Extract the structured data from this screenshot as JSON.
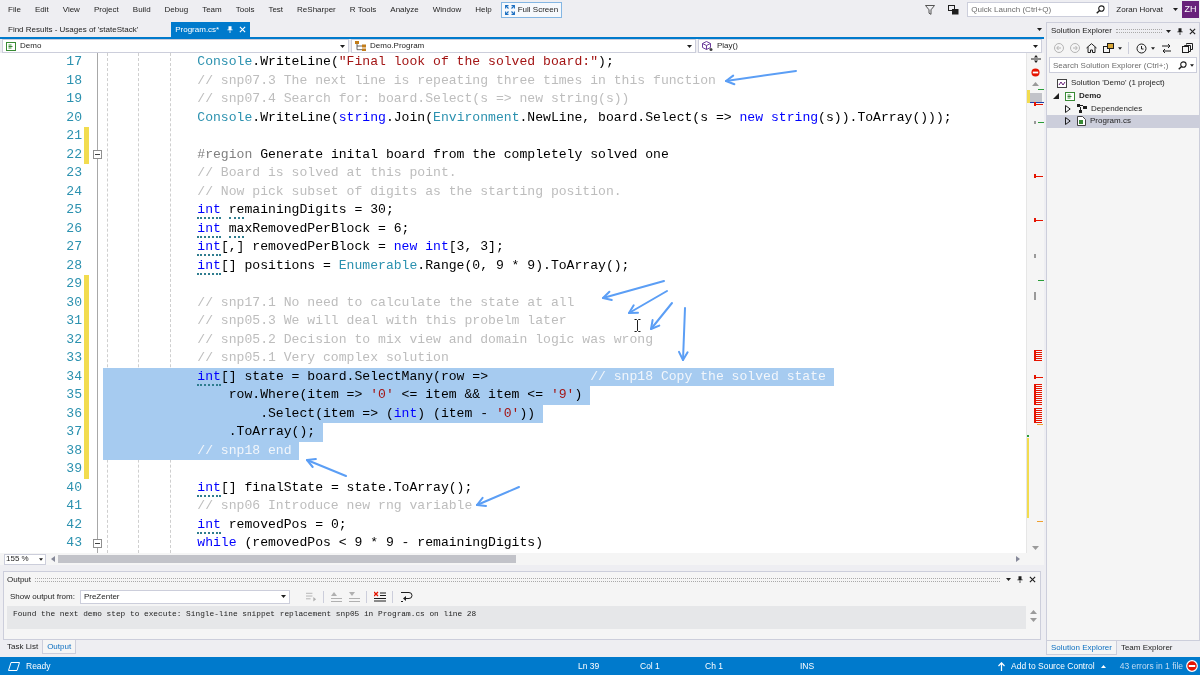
{
  "menu_bar": {
    "items": [
      "File",
      "Edit",
      "View",
      "Project",
      "Build",
      "Debug",
      "Team",
      "Tools",
      "Test",
      "ReSharper",
      "R Tools",
      "Analyze",
      "Window",
      "Help"
    ],
    "full_screen": "Full Screen",
    "quick_launch": {
      "placeholder": "Quick Launch (Ctrl+Q)"
    },
    "user_name": "Zoran Horvat",
    "user_initials": "ZH"
  },
  "document_tabs": [
    {
      "label": "Find Results - Usages of 'stateStack'",
      "selected": false
    },
    {
      "label": "Program.cs*",
      "selected": true
    }
  ],
  "navigation_bar": {
    "project": "Demo",
    "type": "Demo.Program",
    "member": "Play()"
  },
  "editor": {
    "zoom": "155 %",
    "lines": [
      {
        "number": "17",
        "changed": false,
        "fold": false,
        "selected": false,
        "tokens": [
          {
            "kind": "type",
            "text": "            Console",
            "hint": false
          },
          {
            "kind": "plain",
            "text": ".WriteLine(",
            "hint": false
          },
          {
            "kind": "string",
            "text": "\"Final look of the solved board:\"",
            "hint": false
          },
          {
            "kind": "plain",
            "text": ");",
            "hint": false
          }
        ]
      },
      {
        "number": "18",
        "changed": false,
        "fold": false,
        "selected": false,
        "tokens": [
          {
            "kind": "comment",
            "text": "            // snp07.3 The next line is repeating three times in this function",
            "hint": false
          }
        ]
      },
      {
        "number": "19",
        "changed": false,
        "fold": false,
        "selected": false,
        "tokens": [
          {
            "kind": "comment",
            "text": "            // snp07.4 Search for: board.Select(s => new string(s))",
            "hint": false
          }
        ]
      },
      {
        "number": "20",
        "changed": false,
        "fold": false,
        "selected": false,
        "tokens": [
          {
            "kind": "type",
            "text": "            Console",
            "hint": false
          },
          {
            "kind": "plain",
            "text": ".WriteLine(",
            "hint": false
          },
          {
            "kind": "keyword",
            "text": "string",
            "hint": false
          },
          {
            "kind": "plain",
            "text": ".Join(",
            "hint": false
          },
          {
            "kind": "type",
            "text": "Environment",
            "hint": false
          },
          {
            "kind": "plain",
            "text": ".NewLine, board.Select(s => ",
            "hint": false
          },
          {
            "kind": "keyword",
            "text": "new string",
            "hint": false
          },
          {
            "kind": "plain",
            "text": "(s)).ToArray()));",
            "hint": false
          }
        ]
      },
      {
        "number": "21",
        "changed": true,
        "fold": false,
        "selected": false
      },
      {
        "number": "22",
        "changed": true,
        "fold": true,
        "selected": false,
        "tokens": [
          {
            "kind": "preprocessor",
            "text": "            #region",
            "hint": false
          },
          {
            "kind": "plain",
            "text": " Generate inital board from the completely solved one",
            "hint": false
          }
        ]
      },
      {
        "number": "23",
        "changed": false,
        "fold": false,
        "selected": false,
        "tokens": [
          {
            "kind": "comment",
            "text": "            // Board is solved at this point.",
            "hint": false
          }
        ]
      },
      {
        "number": "24",
        "changed": false,
        "fold": false,
        "selected": false,
        "tokens": [
          {
            "kind": "comment",
            "text": "            // Now pick subset of digits as the starting position.",
            "hint": false
          }
        ]
      },
      {
        "number": "25",
        "changed": false,
        "fold": false,
        "selected": false,
        "tokens": [
          {
            "kind": "keyword",
            "text": "            int ",
            "hint": true
          },
          {
            "kind": "plain",
            "text": "re",
            "hint": true
          },
          {
            "kind": "plain",
            "text": "mainingDigits = 30;",
            "hint": false
          }
        ]
      },
      {
        "number": "26",
        "changed": false,
        "fold": false,
        "selected": false,
        "tokens": [
          {
            "kind": "keyword",
            "text": "            int ",
            "hint": true
          },
          {
            "kind": "plain",
            "text": "ma",
            "hint": true
          },
          {
            "kind": "plain",
            "text": "xRemovedPerBlock = 6;",
            "hint": false
          }
        ]
      },
      {
        "number": "27",
        "changed": false,
        "fold": false,
        "selected": false,
        "tokens": [
          {
            "kind": "keyword",
            "text": "            int",
            "hint": true
          },
          {
            "kind": "plain",
            "text": "[,] removedPerBlock = ",
            "hint": false
          },
          {
            "kind": "keyword",
            "text": "new int",
            "hint": false
          },
          {
            "kind": "plain",
            "text": "[3, 3];",
            "hint": false
          }
        ]
      },
      {
        "number": "28",
        "changed": false,
        "fold": false,
        "selected": false,
        "tokens": [
          {
            "kind": "keyword",
            "text": "            int",
            "hint": true
          },
          {
            "kind": "plain",
            "text": "[] positions = ",
            "hint": false
          },
          {
            "kind": "type",
            "text": "Enumerable",
            "hint": false
          },
          {
            "kind": "plain",
            "text": ".Range(0, 9 * 9).ToArray();",
            "hint": false
          }
        ]
      },
      {
        "number": "29",
        "changed": true,
        "fold": false,
        "selected": false
      },
      {
        "number": "30",
        "changed": true,
        "fold": false,
        "selected": false,
        "tokens": [
          {
            "kind": "comment",
            "text": "            // snp17.1 No need to calculate the state at all",
            "hint": false
          }
        ]
      },
      {
        "number": "31",
        "changed": true,
        "fold": false,
        "selected": false,
        "tokens": [
          {
            "kind": "comment",
            "text": "            // snp05.3 We will deal with this probelm later",
            "hint": false
          }
        ]
      },
      {
        "number": "32",
        "changed": true,
        "fold": false,
        "selected": false,
        "tokens": [
          {
            "kind": "comment",
            "text": "            // snp05.2 Decision to mix view and domain logic was wrong",
            "hint": false
          }
        ]
      },
      {
        "number": "33",
        "changed": true,
        "fold": false,
        "selected": false,
        "tokens": [
          {
            "kind": "comment",
            "text": "            // snp05.1 Very complex solution",
            "hint": false
          }
        ]
      },
      {
        "number": "34",
        "changed": true,
        "fold": false,
        "selected": true,
        "tokens": [
          {
            "kind": "keyword",
            "text": "            int",
            "hint": true
          },
          {
            "kind": "plain",
            "text": "[] state = board.SelectMany(row =>             ",
            "hint": false
          },
          {
            "kind": "comment",
            "text": "// snp18 Copy the solved state",
            "hint": false
          }
        ]
      },
      {
        "number": "35",
        "changed": true,
        "fold": false,
        "selected": true,
        "tokens": [
          {
            "kind": "plain",
            "text": "                row.Where(item => ",
            "hint": false
          },
          {
            "kind": "string",
            "text": "'0'",
            "hint": false
          },
          {
            "kind": "plain",
            "text": " <= item && item <= ",
            "hint": false
          },
          {
            "kind": "string",
            "text": "'9'",
            "hint": false
          },
          {
            "kind": "plain",
            "text": ")",
            "hint": false
          }
        ]
      },
      {
        "number": "36",
        "changed": true,
        "fold": false,
        "selected": true,
        "tokens": [
          {
            "kind": "plain",
            "text": "                    .Select(item => (",
            "hint": false
          },
          {
            "kind": "keyword",
            "text": "int",
            "hint": false
          },
          {
            "kind": "plain",
            "text": ") (item - ",
            "hint": false
          },
          {
            "kind": "string",
            "text": "'0'",
            "hint": false
          },
          {
            "kind": "plain",
            "text": "))",
            "hint": false
          }
        ]
      },
      {
        "number": "37",
        "changed": true,
        "fold": false,
        "selected": true,
        "tokens": [
          {
            "kind": "plain",
            "text": "                .ToArray();",
            "hint": false
          }
        ]
      },
      {
        "number": "38",
        "changed": true,
        "fold": false,
        "selected": true,
        "tokens": [
          {
            "kind": "comment",
            "text": "            // snp18 end",
            "hint": false
          }
        ]
      },
      {
        "number": "39",
        "changed": true,
        "fold": false,
        "selected": false
      },
      {
        "number": "40",
        "changed": false,
        "fold": false,
        "selected": false,
        "tokens": [
          {
            "kind": "keyword",
            "text": "            int",
            "hint": true
          },
          {
            "kind": "plain",
            "text": "[] finalState = state.ToArray();",
            "hint": false
          }
        ]
      },
      {
        "number": "41",
        "changed": false,
        "fold": false,
        "selected": false,
        "tokens": [
          {
            "kind": "comment",
            "text": "            // snp06 Introduce new rng variable",
            "hint": false
          }
        ]
      },
      {
        "number": "42",
        "changed": false,
        "fold": false,
        "selected": false,
        "tokens": [
          {
            "kind": "keyword",
            "text": "            int",
            "hint": true
          },
          {
            "kind": "plain",
            "text": " removedPos = 0;",
            "hint": false
          }
        ]
      },
      {
        "number": "43",
        "changed": false,
        "fold": true,
        "selected": false,
        "tokens": [
          {
            "kind": "keyword",
            "text": "            while",
            "hint": false
          },
          {
            "kind": "plain",
            "text": " (removedPos < 9 * 9 - remainingDigits)",
            "hint": false
          }
        ]
      }
    ]
  },
  "output": {
    "title": "Output",
    "source_label": "Show output from:",
    "source": "PreZenter",
    "text": "Found the next demo step to execute: Single-line snippet replacement snp05 in Program.cs on line 28"
  },
  "output_tabs": [
    {
      "label": "Task List",
      "selected": false
    },
    {
      "label": "Output",
      "selected": true
    }
  ],
  "solution_explorer": {
    "title": "Solution Explorer",
    "search": {
      "placeholder": "Search Solution Explorer (Ctrl+;)"
    },
    "tree": [
      {
        "label": "Solution 'Demo' (1 project)",
        "kind": "solution",
        "selected": false,
        "children": [
          {
            "label": "Demo",
            "kind": "project",
            "expanded": true,
            "selected": false,
            "children": [
              {
                "label": "Dependencies",
                "kind": "dependencies",
                "expanded": false,
                "selected": false
              },
              {
                "label": "Program.cs",
                "kind": "file",
                "expanded": false,
                "selected": true
              }
            ]
          }
        ]
      }
    ]
  },
  "explorer_tabs": [
    {
      "label": "Solution Explorer",
      "selected": true
    },
    {
      "label": "Team Explorer",
      "selected": false
    }
  ],
  "status_bar": {
    "message": "Ready",
    "line": "Ln 39",
    "column": "Col 1",
    "character": "Ch 1",
    "mode": "INS",
    "source_control": "Add to Source Control",
    "errors": "43 errors in 1 file"
  }
}
